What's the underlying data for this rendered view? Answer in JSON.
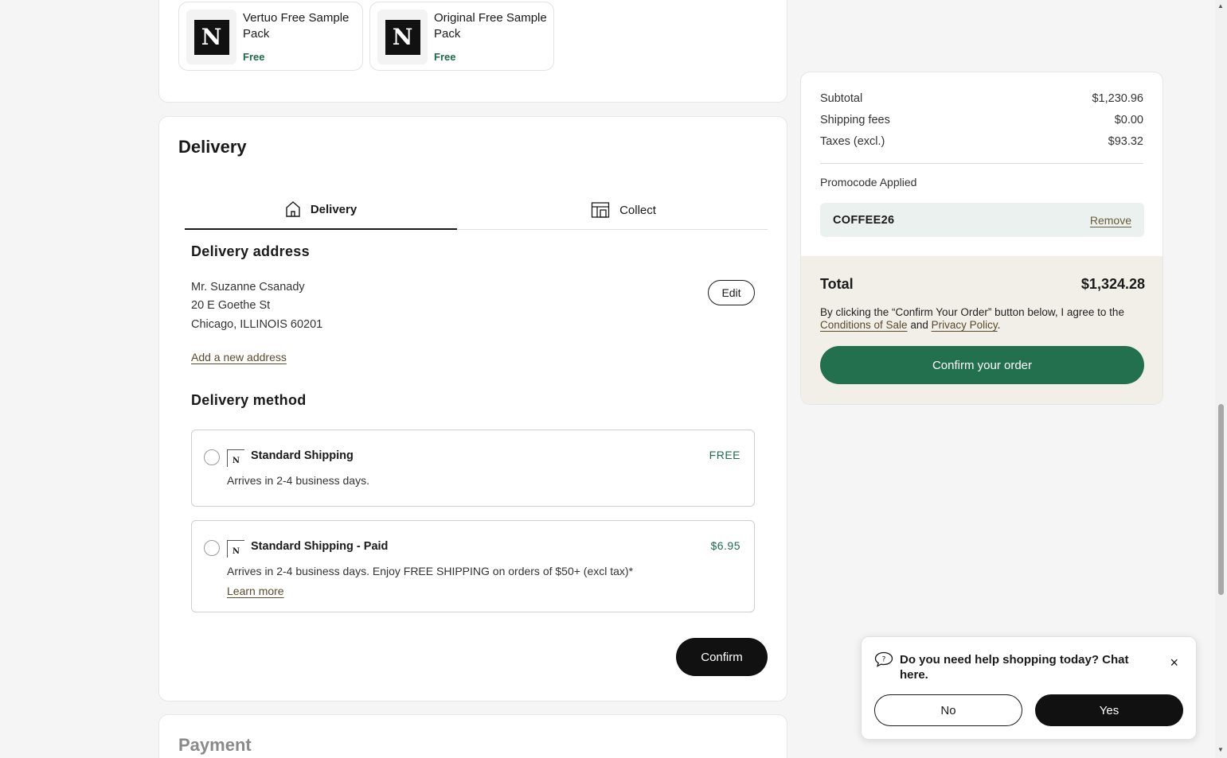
{
  "gifts": [
    {
      "name": "Vertuo Free Sample Pack",
      "price": "Free",
      "logo": "N"
    },
    {
      "name": "Original Free Sample Pack",
      "price": "Free",
      "logo": "N"
    }
  ],
  "delivery": {
    "title": "Delivery",
    "tabs": {
      "delivery": "Delivery",
      "collect": "Collect"
    },
    "address_title": "Delivery address",
    "address": {
      "name": "Mr. Suzanne Csanady",
      "street": "20 E Goethe St",
      "city": "Chicago, ILLINOIS 60201"
    },
    "edit_label": "Edit",
    "add_address_label": "Add a new address",
    "method_title": "Delivery method",
    "methods": [
      {
        "name": "Standard Shipping",
        "price": "FREE",
        "description": "Arrives in 2-4 business days."
      },
      {
        "name": "Standard Shipping - Paid",
        "price": "$6.95",
        "description": "Arrives in 2-4 business days. Enjoy FREE SHIPPING on orders of $50+ (excl tax)*",
        "learn_more": "Learn more"
      }
    ],
    "confirm_label": "Confirm"
  },
  "payment": {
    "title": "Payment"
  },
  "summary": {
    "subtotal_label": "Subtotal",
    "subtotal": "$1,230.96",
    "shipping_label": "Shipping fees",
    "shipping": "$0.00",
    "taxes_label": "Taxes (excl.)",
    "taxes": "$93.32",
    "promo_label": "Promocode Applied",
    "promo_code": "COFFEE26",
    "promo_remove": "Remove",
    "total_label": "Total",
    "total": "$1,324.28",
    "terms_prefix": "By clicking the “Confirm Your Order” button below, I agree to the",
    "terms_conditions": "Conditions of Sale",
    "terms_and": "and",
    "terms_privacy": "Privacy Policy",
    "terms_suffix": ".",
    "confirm_order_label": "Confirm your order"
  },
  "chat": {
    "question": "Do you need help shopping today? Chat here.",
    "no_label": "No",
    "yes_label": "Yes",
    "close_icon": "×"
  },
  "colors": {
    "accent_green": "#23704f",
    "price_green": "#1e6b4a",
    "link_brown": "#5a4a2c"
  }
}
